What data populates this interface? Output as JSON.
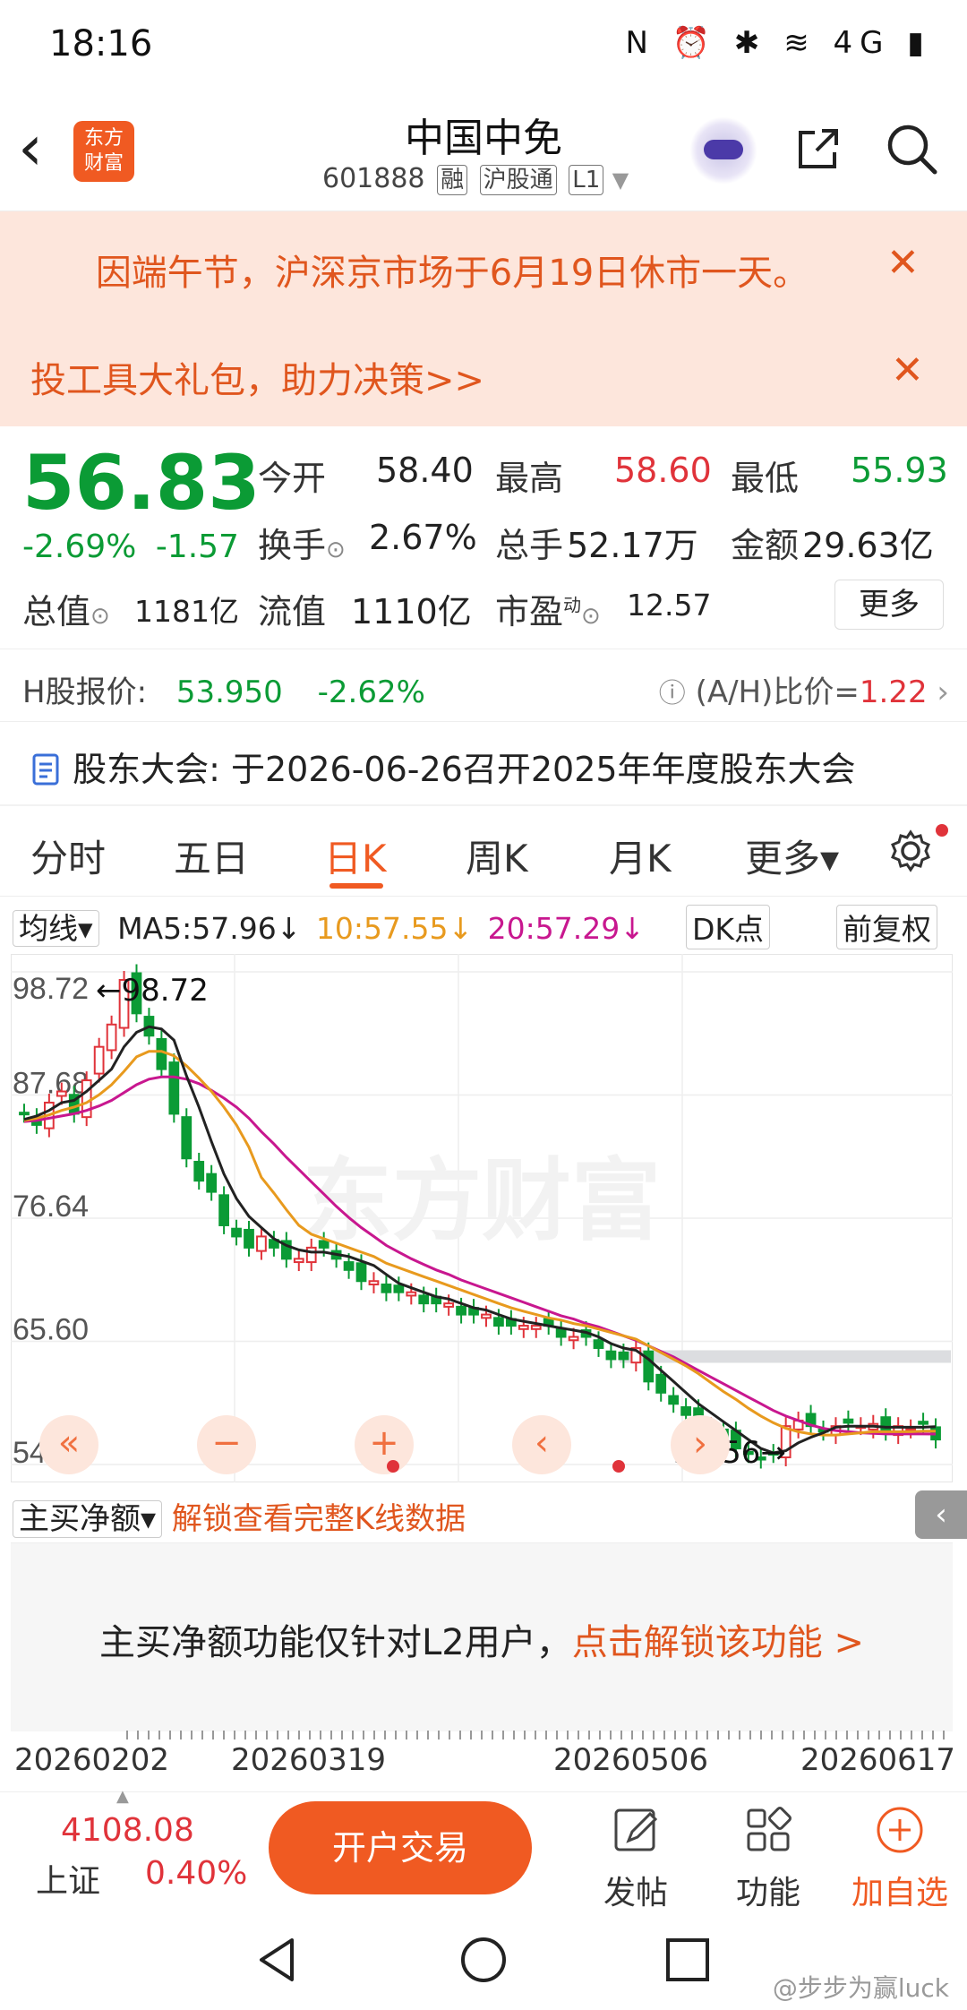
{
  "status_bar": {
    "time": "18:16",
    "icons": "N ⏰ ✱ ≋ 4G ▮"
  },
  "header": {
    "title": "中国中免",
    "code": "601888",
    "tags": [
      "融",
      "沪股通",
      "L1"
    ],
    "logo_text_top": "东方",
    "logo_text_bottom": "财富"
  },
  "notices": [
    {
      "text": "因端午节，沪深京市场于6月19日休市一天。",
      "close": "✕"
    },
    {
      "text": "投工具大礼包，助力决策>>",
      "close": "✕"
    }
  ],
  "quote": {
    "price": "56.83",
    "change_pct": "-2.69%",
    "change_abs": "-1.57",
    "open_label": "今开",
    "open": "58.40",
    "high_label": "最高",
    "high": "58.60",
    "low_label": "最低",
    "low": "55.93",
    "turnover_label": "换手",
    "turnover": "2.67%",
    "volume_label": "总手",
    "volume": "52.17万",
    "amount_label": "金额",
    "amount": "29.63亿",
    "mktcap_label": "总值",
    "mktcap": "1181亿",
    "float_label": "流值",
    "float_cap": "1110亿",
    "pe_label": "市盈",
    "pe_sup": "动",
    "pe": "12.57",
    "more": "更多"
  },
  "h_share": {
    "label": "H股报价:",
    "price": "53.950",
    "pct": "-2.62%",
    "ratio_label": "(A/H)比价=",
    "ratio": "1.22"
  },
  "meeting": {
    "label": "股东大会:",
    "text": "于2026-06-26召开2025年年度股东大会"
  },
  "tabs": [
    "分时",
    "五日",
    "日K",
    "周K",
    "月K",
    "更多▾"
  ],
  "active_tab": "日K",
  "ma_line": {
    "selector": "均线▾",
    "ma5": "MA5:57.96↓",
    "ma10": "10:57.55↓",
    "ma20": "20:57.29↓",
    "dk": "DK点",
    "adjust": "前复权"
  },
  "chart_data": {
    "type": "candlestick",
    "y_ticks": [
      "98.72",
      "87.68",
      "76.64",
      "65.60",
      "54.56"
    ],
    "ylim": [
      54.56,
      98.72
    ],
    "x_ticks": [
      "20260202",
      "20260319",
      "20260506",
      "20260617"
    ],
    "annotations": {
      "max": "98.72",
      "min": "54.56"
    },
    "watermark": "东方财富",
    "colors": {
      "up": "#e0333a",
      "down": "#0b9b35",
      "ma5": "#222222",
      "ma10": "#e89a1e",
      "ma20": "#c8178f"
    },
    "close_values": [
      86,
      85,
      87,
      88,
      86,
      89,
      92,
      94,
      98,
      95,
      93,
      90,
      86,
      82,
      80,
      79,
      76,
      75,
      74,
      75,
      74,
      73,
      73,
      74,
      74,
      73,
      72,
      71,
      71,
      70,
      70,
      70,
      69,
      69,
      69,
      68,
      68,
      68,
      67,
      67,
      67,
      67,
      67,
      66,
      66,
      66,
      65,
      64,
      64,
      65,
      62,
      61,
      60,
      59,
      58,
      58,
      57,
      56,
      55.5,
      55,
      55.5,
      58,
      58.5,
      58,
      57.5,
      58,
      58.3,
      58,
      58.2,
      57.5,
      58,
      57.8,
      58.2,
      56.8
    ],
    "ma5_values": [
      85.5,
      85.8,
      86.3,
      87,
      87.2,
      88,
      89,
      90,
      92,
      93.3,
      93.8,
      93.6,
      92.6,
      89.4,
      86.6,
      83.5,
      80.6,
      78.4,
      76.8,
      75.8,
      74.8,
      74.2,
      73.8,
      73.6,
      73.6,
      73.4,
      73.2,
      72.8,
      72.4,
      71.6,
      70.8,
      70.4,
      70,
      69.6,
      69.4,
      69,
      68.6,
      68.4,
      68,
      67.6,
      67.4,
      67.2,
      67,
      66.8,
      66.6,
      66.4,
      66,
      65.4,
      65,
      64.8,
      64,
      63,
      62,
      61,
      60,
      59.2,
      58.4,
      57.6,
      56.8,
      56,
      55.6,
      55.8,
      56.5,
      57,
      57.4,
      57.9,
      58,
      58,
      58,
      57.9,
      57.9,
      57.9,
      57.9,
      57.96
    ],
    "ma10_values": [
      85.4,
      85.6,
      85.9,
      86.3,
      86.6,
      87,
      87.7,
      88.6,
      89.8,
      91.1,
      91.6,
      91.6,
      91.2,
      90.3,
      89.2,
      88,
      86.6,
      85,
      83,
      80.3,
      78.9,
      77.4,
      76,
      75.2,
      74.8,
      74.4,
      74,
      73.6,
      73.2,
      72.6,
      72.2,
      71.8,
      71.4,
      71,
      70.6,
      70.2,
      69.8,
      69.4,
      69,
      68.6,
      68.3,
      68,
      67.7,
      67.5,
      67.2,
      67,
      66.7,
      66.4,
      66.1,
      65.8,
      65.2,
      64.6,
      64,
      63.4,
      62.7,
      61.9,
      61.1,
      60.4,
      59.6,
      58.9,
      58.3,
      57.8,
      57.5,
      57.3,
      57.2,
      57.2,
      57.3,
      57.4,
      57.5,
      57.5,
      57.5,
      57.5,
      57.55,
      57.55
    ],
    "ma20_values": [
      85.3,
      85.4,
      85.6,
      85.8,
      86,
      86.3,
      86.7,
      87.2,
      87.9,
      88.6,
      89.1,
      89.3,
      89.3,
      89.1,
      88.7,
      88.1,
      87.4,
      86.6,
      85.6,
      84.4,
      83.3,
      82.1,
      81,
      79.9,
      78.8,
      77.7,
      76.7,
      75.8,
      75,
      74.2,
      73.6,
      73,
      72.5,
      72,
      71.6,
      71.1,
      70.7,
      70.3,
      69.9,
      69.5,
      69.1,
      68.7,
      68.3,
      67.9,
      67.6,
      67.2,
      66.9,
      66.5,
      66.1,
      65.7,
      65.2,
      64.7,
      64.2,
      63.6,
      63,
      62.4,
      61.8,
      61.2,
      60.6,
      60,
      59.4,
      58.9,
      58.5,
      58.1,
      57.8,
      57.6,
      57.5,
      57.4,
      57.35,
      57.3,
      57.3,
      57.3,
      57.3,
      57.29
    ]
  },
  "zoom_controls": [
    "«",
    "−",
    "+",
    "‹",
    "›"
  ],
  "indicator": {
    "selector": "主买净额▾",
    "unlock_link": "解锁查看完整K线数据",
    "panel_text": "主买净额功能仅针对L2用户，",
    "panel_link": "点击解锁该功能 >",
    "side_arrow": "‹"
  },
  "bottom_bar": {
    "index_value": "4108.08",
    "index_name": "上证",
    "index_pct": "0.40%",
    "trade_button": "开户交易",
    "functions": [
      {
        "label": "发帖",
        "icon": "edit-icon"
      },
      {
        "label": "功能",
        "icon": "grid-icon"
      },
      {
        "label": "加自选",
        "icon": "add-circle-icon"
      }
    ]
  },
  "watermark_user": "@步步为赢luck"
}
